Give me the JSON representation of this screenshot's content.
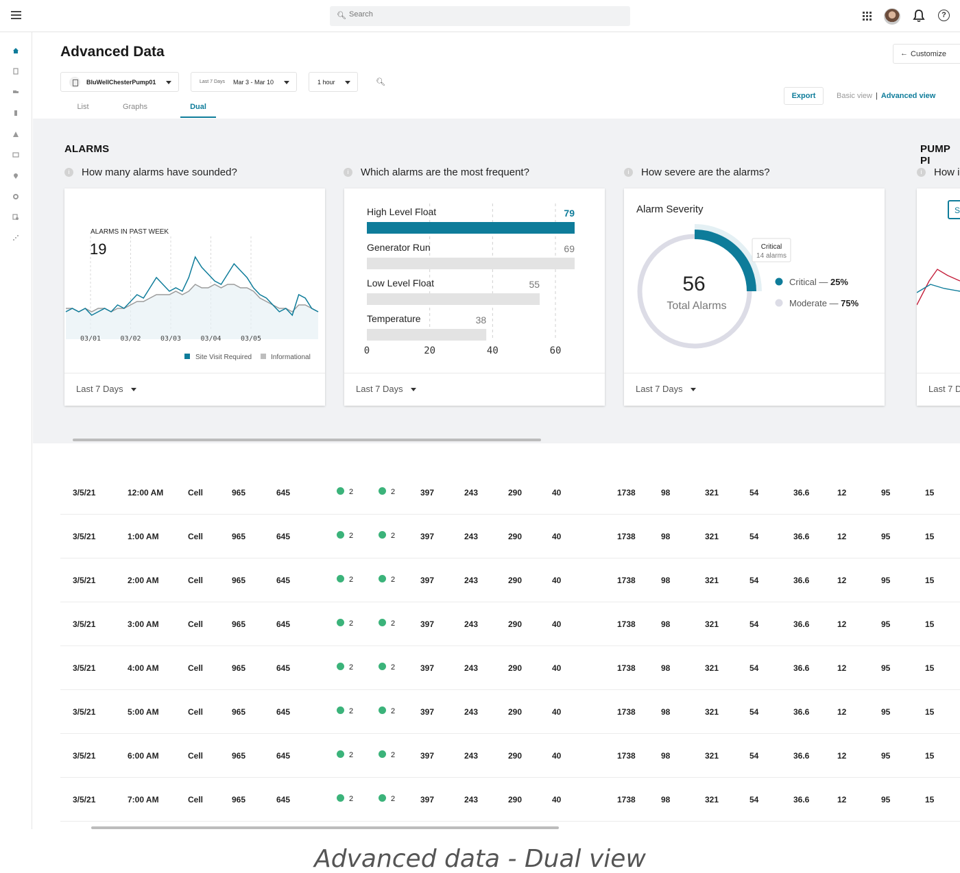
{
  "search": {
    "placeholder": "Search"
  },
  "page": {
    "title": "Advanced Data",
    "customize_label": "Customize"
  },
  "filters": {
    "pump": "BluWellChesterPump01",
    "date_preset": "Last 7 Days",
    "date_range": "Mar 3 - Mar 10",
    "interval": "1 hour"
  },
  "actions": {
    "export": "Export",
    "basic_view": "Basic view",
    "separator": "|",
    "advanced_view": "Advanced view"
  },
  "tabs": [
    {
      "label": "List"
    },
    {
      "label": "Graphs"
    },
    {
      "label": "Dual"
    }
  ],
  "alarms": {
    "section_title": "ALARMS",
    "q1": "How many alarms have sounded?",
    "q2": "Which alarms are the most frequent?",
    "q3": "How severe are the alarms?",
    "footer": "Last 7 Days"
  },
  "pump_section": {
    "title": "PUMP PI",
    "question": "How i",
    "button": "Su",
    "footer": "Last 7 D"
  },
  "chart_data": [
    {
      "type": "line",
      "title": "ALARMS IN PAST WEEK",
      "headline_value": "19",
      "x_ticks": [
        "03/01",
        "03/02",
        "03/03",
        "03/04",
        "03/05"
      ],
      "series": [
        {
          "name": "Site Visit Required",
          "color": "#0e7c9a",
          "values": [
            4,
            5,
            4,
            5,
            3,
            4,
            5,
            4,
            6,
            5,
            7,
            9,
            8,
            11,
            14,
            12,
            10,
            11,
            10,
            14,
            20,
            17,
            15,
            13,
            12,
            15,
            18,
            16,
            14,
            11,
            9,
            8,
            6,
            4,
            5,
            3,
            9,
            8,
            5,
            4
          ]
        },
        {
          "name": "Informational",
          "color": "#9b9b9b",
          "values": [
            5,
            5,
            4,
            5,
            4,
            5,
            5,
            4,
            5,
            5,
            6,
            7,
            7,
            8,
            9,
            9,
            9,
            10,
            9,
            10,
            12,
            11,
            11,
            12,
            11,
            12,
            12,
            11,
            11,
            10,
            8,
            7,
            6,
            5,
            5,
            4,
            6,
            6,
            5,
            4
          ]
        }
      ],
      "legend_position": "bottom-right"
    },
    {
      "type": "bar",
      "orientation": "horizontal",
      "categories": [
        "High Level Float",
        "Generator Run",
        "Low Level Float",
        "Temperature"
      ],
      "values": [
        79,
        69,
        55,
        38
      ],
      "x_ticks": [
        "0",
        "20",
        "40",
        "60"
      ],
      "xlim": [
        0,
        60
      ],
      "highlight_color": "#0e7c9a",
      "bar_color": "#e3e3e3"
    },
    {
      "type": "pie",
      "style": "donut",
      "title": "Alarm Severity",
      "center_value": "56",
      "center_label": "Total Alarms",
      "tooltip": {
        "title": "Critical",
        "detail": "14 alarms"
      },
      "slices": [
        {
          "name": "Critical",
          "percent_label": "25%",
          "value": 25,
          "color": "#0e7c9a"
        },
        {
          "name": "Moderate",
          "percent_label": "75%",
          "value": 75,
          "color": "#dcdce6"
        }
      ],
      "separator": "—"
    }
  ],
  "table": {
    "rows": [
      [
        "3/5/21",
        "12:00 AM",
        "Cell",
        "965",
        "645",
        "2",
        "2",
        "397",
        "243",
        "290",
        "40",
        "1738",
        "98",
        "321",
        "54",
        "36.6",
        "12",
        "95",
        "15"
      ],
      [
        "3/5/21",
        "1:00 AM",
        "Cell",
        "965",
        "645",
        "2",
        "2",
        "397",
        "243",
        "290",
        "40",
        "1738",
        "98",
        "321",
        "54",
        "36.6",
        "12",
        "95",
        "15"
      ],
      [
        "3/5/21",
        "2:00 AM",
        "Cell",
        "965",
        "645",
        "2",
        "2",
        "397",
        "243",
        "290",
        "40",
        "1738",
        "98",
        "321",
        "54",
        "36.6",
        "12",
        "95",
        "15"
      ],
      [
        "3/5/21",
        "3:00 AM",
        "Cell",
        "965",
        "645",
        "2",
        "2",
        "397",
        "243",
        "290",
        "40",
        "1738",
        "98",
        "321",
        "54",
        "36.6",
        "12",
        "95",
        "15"
      ],
      [
        "3/5/21",
        "4:00 AM",
        "Cell",
        "965",
        "645",
        "2",
        "2",
        "397",
        "243",
        "290",
        "40",
        "1738",
        "98",
        "321",
        "54",
        "36.6",
        "12",
        "95",
        "15"
      ],
      [
        "3/5/21",
        "5:00 AM",
        "Cell",
        "965",
        "645",
        "2",
        "2",
        "397",
        "243",
        "290",
        "40",
        "1738",
        "98",
        "321",
        "54",
        "36.6",
        "12",
        "95",
        "15"
      ],
      [
        "3/5/21",
        "6:00 AM",
        "Cell",
        "965",
        "645",
        "2",
        "2",
        "397",
        "243",
        "290",
        "40",
        "1738",
        "98",
        "321",
        "54",
        "36.6",
        "12",
        "95",
        "15"
      ],
      [
        "3/5/21",
        "7:00 AM",
        "Cell",
        "965",
        "645",
        "2",
        "2",
        "397",
        "243",
        "290",
        "40",
        "1738",
        "98",
        "321",
        "54",
        "36.6",
        "12",
        "95",
        "15"
      ]
    ],
    "status_color": "#3bb37a"
  },
  "caption": "Advanced data - Dual view"
}
